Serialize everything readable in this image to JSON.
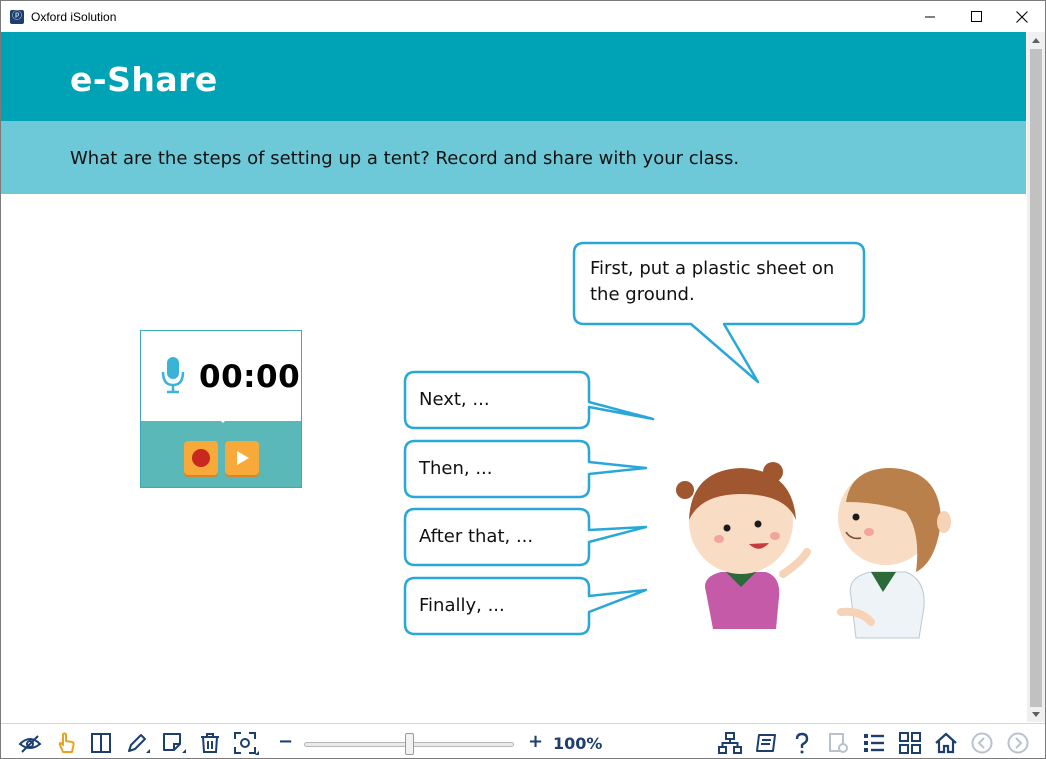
{
  "window": {
    "title": "Oxford iSolution",
    "icon": "oxford-app-icon"
  },
  "header": {
    "title": "e-Share"
  },
  "instruction": {
    "text": "What are the steps of setting up a tent? Record and share with your class."
  },
  "recorder": {
    "timer": "00:00",
    "mic_icon": "microphone-icon",
    "record_icon": "record-icon",
    "play_icon": "play-icon"
  },
  "bubbles": {
    "first": [
      "First, put a plastic sheet on",
      "the ground."
    ],
    "next": "Next, ...",
    "then": "Then, ...",
    "after": "After that, ...",
    "finally": "Finally, ..."
  },
  "toolbar": {
    "zoom_minus": "−",
    "zoom_plus": "+",
    "zoom_level": "100%",
    "zoom_fraction": 0.5,
    "icons": [
      "eye-slash-icon",
      "hand-pointer-icon",
      "split-view-icon",
      "pen-icon",
      "sticky-note-icon",
      "trash-icon",
      "screenshot-icon",
      "sitemap-icon",
      "notebook-icon",
      "help-icon",
      "settings-icon",
      "list-icon",
      "grid-icon",
      "home-icon",
      "previous-icon",
      "next-icon"
    ]
  },
  "colors": {
    "header_bg": "#00a3b6",
    "instruction_bg": "#6dc8d7",
    "recorder_bottom": "#5bb8b8",
    "button_orange": "#f7a93a",
    "bubble_stroke": "#2aa7d9",
    "toolbar_icon": "#1c3f6e"
  }
}
